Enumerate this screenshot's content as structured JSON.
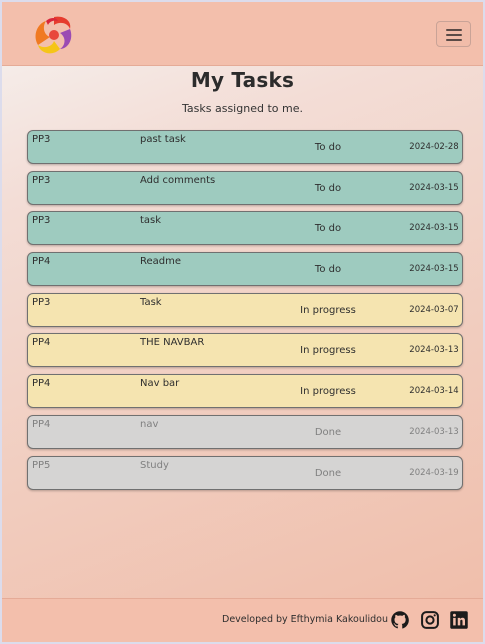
{
  "header": {
    "logo_icon": "swirl-logo-icon",
    "menu_icon": "hamburger-menu-icon"
  },
  "main": {
    "title": "My Tasks",
    "subtitle": "Tasks assigned to me."
  },
  "tasks": [
    {
      "project": "PP3",
      "title": "past task",
      "status": "To do",
      "date": "2024-02-28",
      "state": "todo"
    },
    {
      "project": "PP3",
      "title": "Add comments",
      "status": "To do",
      "date": "2024-03-15",
      "state": "todo"
    },
    {
      "project": "PP3",
      "title": "task",
      "status": "To do",
      "date": "2024-03-15",
      "state": "todo"
    },
    {
      "project": "PP4",
      "title": "Readme",
      "status": "To do",
      "date": "2024-03-15",
      "state": "todo"
    },
    {
      "project": "PP3",
      "title": "Task",
      "status": "In progress",
      "date": "2024-03-07",
      "state": "progress"
    },
    {
      "project": "PP4",
      "title": "THE NAVBAR",
      "status": "In progress",
      "date": "2024-03-13",
      "state": "progress"
    },
    {
      "project": "PP4",
      "title": "Nav bar",
      "status": "In progress",
      "date": "2024-03-14",
      "state": "progress"
    },
    {
      "project": "PP4",
      "title": "nav",
      "status": "Done",
      "date": "2024-03-13",
      "state": "done"
    },
    {
      "project": "PP5",
      "title": "Study",
      "status": "Done",
      "date": "2024-03-19",
      "state": "done"
    }
  ],
  "footer": {
    "credit": "Developed by Efthymia Kakoulidou",
    "icons": [
      "github-icon",
      "instagram-icon",
      "linkedin-icon"
    ]
  },
  "colors": {
    "todo": "#9ecbbf",
    "in_progress": "#f5e4b0",
    "done": "#d5d4d3",
    "navbar": "#f3bfac"
  }
}
